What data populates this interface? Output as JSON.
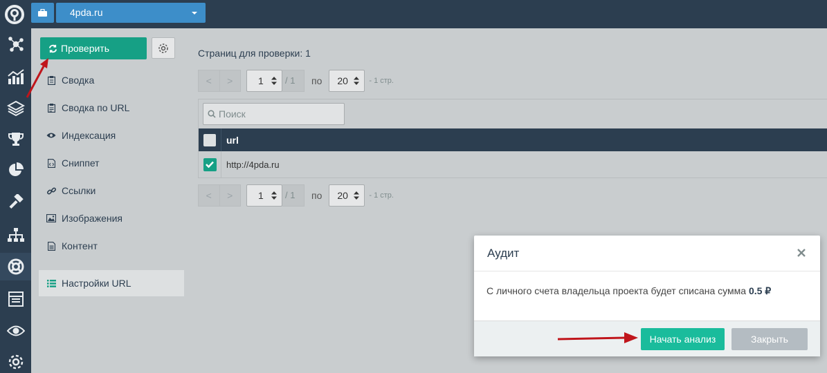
{
  "topbar": {
    "project": "4pda.ru"
  },
  "rail": {
    "items": [
      "network-icon",
      "chart-icon",
      "layers-icon",
      "trophy-icon",
      "pie-chart-icon",
      "hammer-icon",
      "sitemap-icon",
      "lifebuoy-icon",
      "list-alt-icon",
      "eye-icon",
      "gear-icon"
    ],
    "active": "lifebuoy-icon"
  },
  "sidebar": {
    "check_label": "Проверить",
    "items": [
      {
        "label": "Сводка",
        "icon": "clipboard-icon"
      },
      {
        "label": "Сводка по URL",
        "icon": "clipboard-list-icon"
      },
      {
        "label": "Индексация",
        "icon": "eye-icon"
      },
      {
        "label": "Сниппет",
        "icon": "file-code-icon"
      },
      {
        "label": "Ссылки",
        "icon": "link-icon"
      },
      {
        "label": "Изображения",
        "icon": "image-icon"
      },
      {
        "label": "Контент",
        "icon": "file-text-icon"
      }
    ],
    "active_item": {
      "label": "Настройки URL",
      "icon": "list-icon"
    }
  },
  "main": {
    "pages_title": "Страниц для проверки: 1",
    "pager_top": {
      "prev": "<",
      "next": ">",
      "page": "1",
      "total": "/ 1",
      "per_label": "по",
      "per_page": "20",
      "info": "- 1 стр."
    },
    "pager_bottom": {
      "prev": "<",
      "next": ">",
      "page": "1",
      "total": "/ 1",
      "per_label": "по",
      "per_page": "20",
      "info": "- 1 стр."
    },
    "search_placeholder": "Поиск",
    "table": {
      "column": "url",
      "rows": [
        {
          "url": "http://4pda.ru",
          "checked": true
        }
      ]
    }
  },
  "modal": {
    "title": "Аудит",
    "message": "С личного счета владельца проекта будет списана сумма",
    "amount": "0.5 ₽",
    "start_label": "Начать анализ",
    "close_label": "Закрыть"
  },
  "colors": {
    "accent_green": "#16a085",
    "accent_blue": "#3d8ec9",
    "nav_dark": "#2c3e50",
    "annotation_red": "#c0151b"
  }
}
